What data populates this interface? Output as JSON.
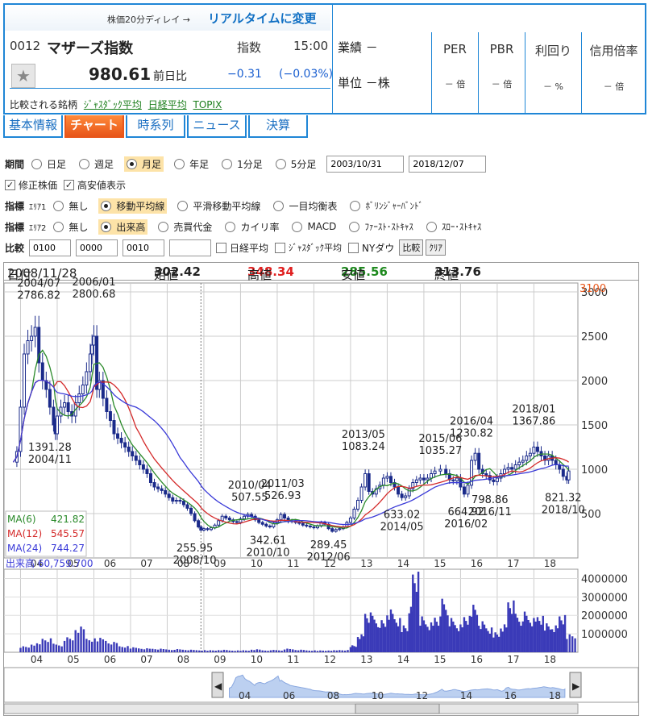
{
  "header": {
    "delay_note": "株価20分ディレイ →",
    "realtime_link": "リアルタイムに変更",
    "code": "0012",
    "name": "マザーズ指数",
    "kind": "指数",
    "time": "15:00",
    "price": "980.61",
    "change_label": "前日比",
    "change": "−0.31",
    "change_pct": "(−0.03%)",
    "compare_label": "比較される銘柄",
    "compare_links": [
      "ｼﾞｬｽﾀﾞｯｸ平均",
      "日経平均",
      "TOPIX"
    ],
    "gyoseki": "業績 －",
    "tani": "単位 －株",
    "ratios": [
      {
        "label": "PER",
        "value": "－ 倍"
      },
      {
        "label": "PBR",
        "value": "－ 倍"
      },
      {
        "label": "利回り",
        "value": "－ %"
      },
      {
        "label": "信用倍率",
        "value": "－ 倍"
      }
    ]
  },
  "tabs": [
    "基本情報",
    "チャート",
    "時系列",
    "ニュース",
    "決算"
  ],
  "active_tab": "チャート",
  "controls": {
    "period_label": "期間",
    "periods": [
      "日足",
      "週足",
      "月足",
      "年足",
      "1分足",
      "5分足"
    ],
    "period_selected": "月足",
    "date_from": "2003/10/31",
    "date_to": "2018/12/07",
    "adjusted_label": "修正株価",
    "highlow_label": "高安値表示",
    "ind1_label": "指標",
    "ind1_sub": "ｴﾘｱ1",
    "ind1_options": [
      "無し",
      "移動平均線",
      "平滑移動平均線",
      "一目均衡表",
      "ﾎﾞﾘﾝｼﾞｬｰﾊﾞﾝﾄﾞ"
    ],
    "ind1_selected": "移動平均線",
    "ind2_label": "指標",
    "ind2_sub": "ｴﾘｱ2",
    "ind2_options": [
      "無し",
      "出来高",
      "売買代金",
      "カイリ率",
      "MACD",
      "ﾌｧｰｽﾄ･ｽﾄｷｬｽ",
      "ｽﾛｰ･ｽﾄｷｬｽ"
    ],
    "ind2_selected": "出来高",
    "compare_label": "比較",
    "compare_codes": [
      "0100",
      "0000",
      "0010",
      ""
    ],
    "compare_checks": [
      "日経平均",
      "ｼﾞｬｽﾀﾞｯｸ平均",
      "NYダウ"
    ],
    "compare_btn": "比較",
    "clear_btn": "ｸﾘｱ"
  },
  "ohlc": {
    "date_label": "日付",
    "date": "2008/11/28",
    "open_label": "始値",
    "open": "302.42",
    "high_label": "高値",
    "high": "348.34",
    "low_label": "安値",
    "low": "285.56",
    "close_label": "終値",
    "close": "313.76"
  },
  "chart_data": {
    "type": "candlestick",
    "ylim": [
      0,
      3100
    ],
    "y_ticks": [
      500,
      1000,
      1500,
      2000,
      2500,
      3000
    ],
    "y_top_label": "3100",
    "x_tick_labels": [
      "04",
      "05",
      "06",
      "07",
      "08",
      "09",
      "10",
      "11",
      "12",
      "13",
      "14",
      "15",
      "16",
      "17",
      "18"
    ],
    "close_series": [
      [
        2003.8,
        1080
      ],
      [
        2003.9,
        1200
      ],
      [
        2004.0,
        1700
      ],
      [
        2004.1,
        2300
      ],
      [
        2004.2,
        2450
      ],
      [
        2004.3,
        2500
      ],
      [
        2004.4,
        2600
      ],
      [
        2004.5,
        2200
      ],
      [
        2004.6,
        2000
      ],
      [
        2004.7,
        1900
      ],
      [
        2004.8,
        1700
      ],
      [
        2004.9,
        1500
      ],
      [
        2004.95,
        1400
      ],
      [
        2005.0,
        1600
      ],
      [
        2005.1,
        1700
      ],
      [
        2005.2,
        1750
      ],
      [
        2005.3,
        1650
      ],
      [
        2005.4,
        1600
      ],
      [
        2005.5,
        1750
      ],
      [
        2005.6,
        1850
      ],
      [
        2005.7,
        1950
      ],
      [
        2005.8,
        2100
      ],
      [
        2005.9,
        2300
      ],
      [
        2005.95,
        2400
      ],
      [
        2006.0,
        2500
      ],
      [
        2006.08,
        1900
      ],
      [
        2006.15,
        2000
      ],
      [
        2006.25,
        1800
      ],
      [
        2006.35,
        1650
      ],
      [
        2006.45,
        1550
      ],
      [
        2006.55,
        1400
      ],
      [
        2006.65,
        1350
      ],
      [
        2006.75,
        1300
      ],
      [
        2006.85,
        1250
      ],
      [
        2006.95,
        1200
      ],
      [
        2007.05,
        1150
      ],
      [
        2007.15,
        1100
      ],
      [
        2007.25,
        1050
      ],
      [
        2007.35,
        1000
      ],
      [
        2007.45,
        950
      ],
      [
        2007.55,
        850
      ],
      [
        2007.65,
        800
      ],
      [
        2007.75,
        780
      ],
      [
        2007.85,
        760
      ],
      [
        2007.95,
        720
      ],
      [
        2008.05,
        680
      ],
      [
        2008.15,
        640
      ],
      [
        2008.25,
        650
      ],
      [
        2008.35,
        640
      ],
      [
        2008.45,
        600
      ],
      [
        2008.55,
        560
      ],
      [
        2008.65,
        500
      ],
      [
        2008.75,
        420
      ],
      [
        2008.85,
        350
      ],
      [
        2008.92,
        314
      ],
      [
        2009.0,
        330
      ],
      [
        2009.1,
        320
      ],
      [
        2009.2,
        340
      ],
      [
        2009.3,
        370
      ],
      [
        2009.4,
        420
      ],
      [
        2009.5,
        470
      ],
      [
        2009.6,
        450
      ],
      [
        2009.7,
        430
      ],
      [
        2009.8,
        410
      ],
      [
        2009.9,
        400
      ],
      [
        2010.0,
        440
      ],
      [
        2010.1,
        470
      ],
      [
        2010.2,
        490
      ],
      [
        2010.3,
        470
      ],
      [
        2010.4,
        430
      ],
      [
        2010.5,
        400
      ],
      [
        2010.6,
        380
      ],
      [
        2010.7,
        360
      ],
      [
        2010.8,
        350
      ],
      [
        2010.9,
        390
      ],
      [
        2011.0,
        430
      ],
      [
        2011.1,
        490
      ],
      [
        2011.2,
        450
      ],
      [
        2011.3,
        410
      ],
      [
        2011.4,
        420
      ],
      [
        2011.5,
        400
      ],
      [
        2011.6,
        390
      ],
      [
        2011.7,
        370
      ],
      [
        2011.8,
        360
      ],
      [
        2011.9,
        350
      ],
      [
        2012.0,
        340
      ],
      [
        2012.1,
        360
      ],
      [
        2012.2,
        400
      ],
      [
        2012.3,
        380
      ],
      [
        2012.4,
        330
      ],
      [
        2012.5,
        300
      ],
      [
        2012.6,
        320
      ],
      [
        2012.7,
        330
      ],
      [
        2012.8,
        350
      ],
      [
        2012.9,
        400
      ],
      [
        2013.0,
        450
      ],
      [
        2013.1,
        550
      ],
      [
        2013.2,
        650
      ],
      [
        2013.3,
        800
      ],
      [
        2013.4,
        950
      ],
      [
        2013.5,
        750
      ],
      [
        2013.6,
        720
      ],
      [
        2013.7,
        780
      ],
      [
        2013.8,
        820
      ],
      [
        2013.9,
        900
      ],
      [
        2014.0,
        920
      ],
      [
        2014.1,
        850
      ],
      [
        2014.2,
        800
      ],
      [
        2014.3,
        720
      ],
      [
        2014.4,
        680
      ],
      [
        2014.5,
        700
      ],
      [
        2014.6,
        780
      ],
      [
        2014.7,
        850
      ],
      [
        2014.8,
        880
      ],
      [
        2014.9,
        900
      ],
      [
        2015.0,
        880
      ],
      [
        2015.1,
        900
      ],
      [
        2015.2,
        950
      ],
      [
        2015.3,
        980
      ],
      [
        2015.45,
        1000
      ],
      [
        2015.6,
        950
      ],
      [
        2015.7,
        880
      ],
      [
        2015.8,
        870
      ],
      [
        2015.9,
        900
      ],
      [
        2016.0,
        800
      ],
      [
        2016.1,
        720
      ],
      [
        2016.2,
        820
      ],
      [
        2016.3,
        1100
      ],
      [
        2016.4,
        1180
      ],
      [
        2016.5,
        1000
      ],
      [
        2016.6,
        950
      ],
      [
        2016.7,
        930
      ],
      [
        2016.8,
        880
      ],
      [
        2016.9,
        860
      ],
      [
        2017.0,
        900
      ],
      [
        2017.1,
        950
      ],
      [
        2017.2,
        1000
      ],
      [
        2017.3,
        1020
      ],
      [
        2017.4,
        1000
      ],
      [
        2017.5,
        1050
      ],
      [
        2017.6,
        1080
      ],
      [
        2017.7,
        1100
      ],
      [
        2017.8,
        1150
      ],
      [
        2017.9,
        1180
      ],
      [
        2018.0,
        1250
      ],
      [
        2018.1,
        1200
      ],
      [
        2018.2,
        1150
      ],
      [
        2018.3,
        1100
      ],
      [
        2018.4,
        1150
      ],
      [
        2018.5,
        1100
      ],
      [
        2018.6,
        1050
      ],
      [
        2018.7,
        1000
      ],
      [
        2018.8,
        920
      ],
      [
        2018.9,
        880
      ],
      [
        2018.95,
        981
      ]
    ],
    "ma_legend": [
      {
        "name": "MA(6)",
        "value": "421.82",
        "color": "#2a8a2a"
      },
      {
        "name": "MA(12)",
        "value": "545.57",
        "color": "#d42a2a"
      },
      {
        "name": "MA(24)",
        "value": "744.27",
        "color": "#3a3ad8"
      }
    ],
    "annotations": [
      {
        "lines": [
          "2004/07",
          "2786.82"
        ],
        "x": 2004.5,
        "y": 2786.82,
        "pos": "above"
      },
      {
        "lines": [
          "2006/01",
          "2800.68"
        ],
        "x": 2006.0,
        "y": 2800.68,
        "pos": "above"
      },
      {
        "lines": [
          "1391.28",
          "2004/11"
        ],
        "x": 2004.8,
        "y": 1391.28,
        "pos": "below"
      },
      {
        "lines": [
          "255.95",
          "2008/10"
        ],
        "x": 2008.75,
        "y": 255.95,
        "pos": "below"
      },
      {
        "lines": [
          "2010/04",
          "507.55"
        ],
        "x": 2010.25,
        "y": 507.55,
        "pos": "above"
      },
      {
        "lines": [
          "2011/03",
          "526.93"
        ],
        "x": 2011.15,
        "y": 526.93,
        "pos": "above"
      },
      {
        "lines": [
          "342.61",
          "2010/10"
        ],
        "x": 2010.75,
        "y": 342.61,
        "pos": "below"
      },
      {
        "lines": [
          "289.45",
          "2012/06"
        ],
        "x": 2012.4,
        "y": 289.45,
        "pos": "below"
      },
      {
        "lines": [
          "2013/05",
          "1083.24"
        ],
        "x": 2013.35,
        "y": 1083.24,
        "pos": "above"
      },
      {
        "lines": [
          "633.02",
          "2014/05"
        ],
        "x": 2014.4,
        "y": 633.02,
        "pos": "below"
      },
      {
        "lines": [
          "2015/06",
          "1035.27"
        ],
        "x": 2015.45,
        "y": 1035.27,
        "pos": "above"
      },
      {
        "lines": [
          "2016/04",
          "1230.82"
        ],
        "x": 2016.3,
        "y": 1230.82,
        "pos": "above"
      },
      {
        "lines": [
          "664.92",
          "2016/02"
        ],
        "x": 2016.15,
        "y": 664.92,
        "pos": "below"
      },
      {
        "lines": [
          "798.86",
          "2016/11"
        ],
        "x": 2016.8,
        "y": 798.86,
        "pos": "below"
      },
      {
        "lines": [
          "2018/01",
          "1367.86"
        ],
        "x": 2018.0,
        "y": 1367.86,
        "pos": "above"
      },
      {
        "lines": [
          "821.32",
          "2018/10"
        ],
        "x": 2018.8,
        "y": 821.32,
        "pos": "below"
      }
    ],
    "volume": {
      "label": "出来高",
      "value": "60,759.700",
      "ylim": [
        0,
        4500000
      ],
      "y_ticks": [
        1000000,
        2000000,
        3000000,
        4000000
      ],
      "y_tick_labels": [
        "1000000",
        "2000000",
        "3000000",
        "4000000"
      ],
      "series": [
        [
          2004.0,
          300000
        ],
        [
          2004.3,
          450000
        ],
        [
          2004.6,
          700000
        ],
        [
          2004.9,
          400000
        ],
        [
          2005.2,
          700000
        ],
        [
          2005.5,
          1200000
        ],
        [
          2005.8,
          650000
        ],
        [
          2006.1,
          700000
        ],
        [
          2006.4,
          500000
        ],
        [
          2006.7,
          300000
        ],
        [
          2007.0,
          250000
        ],
        [
          2007.3,
          200000
        ],
        [
          2007.6,
          180000
        ],
        [
          2007.9,
          150000
        ],
        [
          2008.2,
          150000
        ],
        [
          2008.5,
          120000
        ],
        [
          2008.8,
          100000
        ],
        [
          2009.1,
          100000
        ],
        [
          2009.4,
          120000
        ],
        [
          2009.7,
          90000
        ],
        [
          2010.0,
          100000
        ],
        [
          2010.3,
          150000
        ],
        [
          2010.6,
          100000
        ],
        [
          2010.9,
          110000
        ],
        [
          2011.2,
          170000
        ],
        [
          2011.5,
          120000
        ],
        [
          2011.8,
          90000
        ],
        [
          2012.1,
          90000
        ],
        [
          2012.4,
          100000
        ],
        [
          2012.7,
          110000
        ],
        [
          2013.0,
          350000
        ],
        [
          2013.2,
          900000
        ],
        [
          2013.4,
          2000000
        ],
        [
          2013.6,
          1700000
        ],
        [
          2013.8,
          1500000
        ],
        [
          2014.0,
          2000000
        ],
        [
          2014.2,
          1600000
        ],
        [
          2014.4,
          1300000
        ],
        [
          2014.6,
          2200000
        ],
        [
          2014.7,
          3900000
        ],
        [
          2014.9,
          1800000
        ],
        [
          2015.1,
          1500000
        ],
        [
          2015.3,
          1800000
        ],
        [
          2015.5,
          2500000
        ],
        [
          2015.7,
          1600000
        ],
        [
          2015.9,
          1300000
        ],
        [
          2016.1,
          1700000
        ],
        [
          2016.3,
          2300000
        ],
        [
          2016.5,
          1500000
        ],
        [
          2016.7,
          1200000
        ],
        [
          2016.9,
          1000000
        ],
        [
          2017.1,
          1400000
        ],
        [
          2017.3,
          2600000
        ],
        [
          2017.5,
          1800000
        ],
        [
          2017.7,
          1900000
        ],
        [
          2017.9,
          1600000
        ],
        [
          2018.1,
          1700000
        ],
        [
          2018.3,
          1400000
        ],
        [
          2018.5,
          1300000
        ],
        [
          2018.7,
          1800000
        ],
        [
          2018.9,
          900000
        ]
      ]
    },
    "navigator": {
      "labels": [
        "04",
        "06",
        "08",
        "10",
        "12",
        "14",
        "16",
        "18"
      ]
    }
  }
}
